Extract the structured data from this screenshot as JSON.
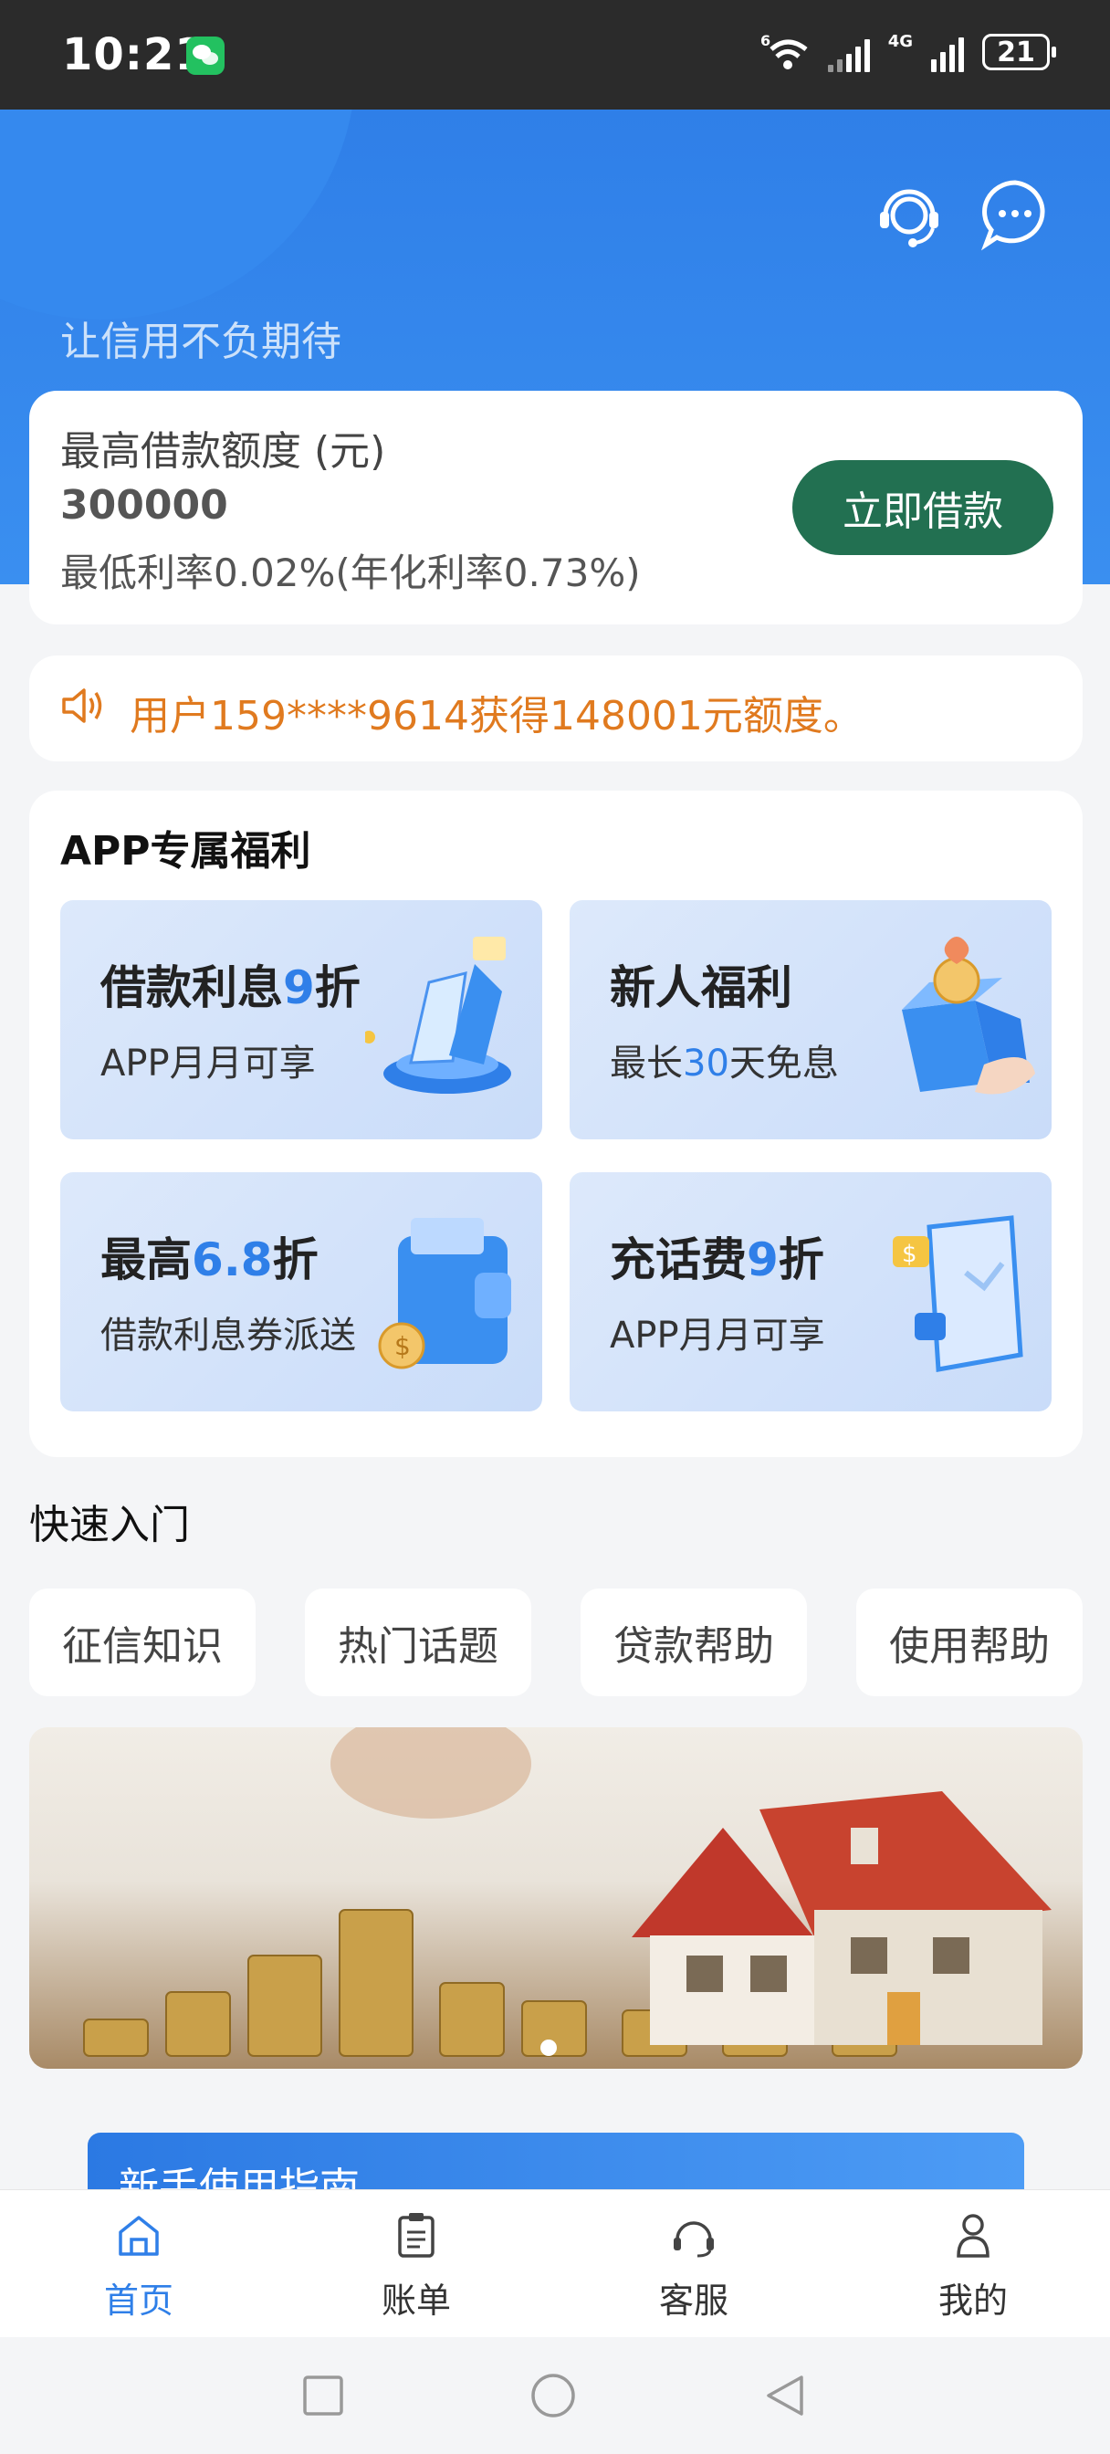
{
  "status_bar": {
    "time": "10:21",
    "wifi_label": "6",
    "network_label": "4G",
    "battery": "21"
  },
  "header": {
    "slogan": "让信用不负期待",
    "icons": [
      "customer-service-icon",
      "message-icon"
    ]
  },
  "loan_card": {
    "limit_label": "最高借款额度 (元)",
    "limit_amount": "300000",
    "rate_text": "最低利率0.02%(年化利率0.73%)",
    "borrow_button": "立即借款"
  },
  "notice": {
    "text": "用户159****9614获得148001元额度。"
  },
  "benefits": {
    "title": "APP专属福利",
    "tiles": [
      {
        "title_prefix": "借款利息",
        "title_highlight": "9",
        "title_suffix": "折",
        "sub_prefix": "APP月月可享",
        "sub_highlight": "",
        "sub_suffix": ""
      },
      {
        "title_prefix": "新人福利",
        "title_highlight": "",
        "title_suffix": "",
        "sub_prefix": "最长",
        "sub_highlight": "30",
        "sub_suffix": "天免息"
      },
      {
        "title_prefix": "最高",
        "title_highlight": "6.8",
        "title_suffix": "折",
        "sub_prefix": "借款利息券派送",
        "sub_highlight": "",
        "sub_suffix": ""
      },
      {
        "title_prefix": "充话费",
        "title_highlight": "9",
        "title_suffix": "折",
        "sub_prefix": "APP月月可享",
        "sub_highlight": "",
        "sub_suffix": ""
      }
    ]
  },
  "quick_entry": {
    "title": "快速入门",
    "items": [
      "征信知识",
      "热门话题",
      "贷款帮助",
      "使用帮助"
    ]
  },
  "guide": {
    "title": "新手使用指南"
  },
  "tabbar": {
    "items": [
      {
        "label": "首页",
        "icon": "home-icon",
        "active": true
      },
      {
        "label": "账单",
        "icon": "bill-icon",
        "active": false
      },
      {
        "label": "客服",
        "icon": "headset-icon",
        "active": false
      },
      {
        "label": "我的",
        "icon": "profile-icon",
        "active": false
      }
    ]
  },
  "colors": {
    "primary_blue": "#2f7fe8",
    "borrow_green": "#227051",
    "notice_orange": "#e07a1f"
  }
}
